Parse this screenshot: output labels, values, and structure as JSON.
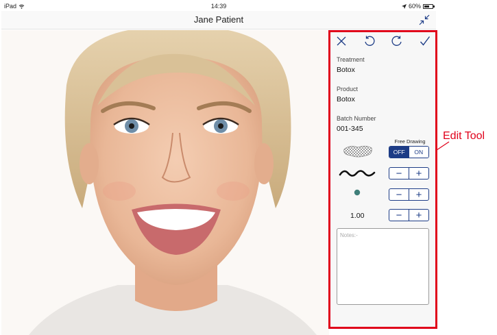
{
  "status_bar": {
    "device": "iPad",
    "time": "14:39",
    "battery": "60%",
    "battery_level": 0.6
  },
  "nav": {
    "title": "Jane Patient",
    "collapse_icon": "collapse-arrows-icon"
  },
  "toolbar": {
    "close_icon": "close-icon",
    "undo_icon": "undo-icon",
    "redo_icon": "redo-icon",
    "confirm_icon": "checkmark-icon"
  },
  "fields": [
    {
      "label": "Treatment",
      "value": "Botox"
    },
    {
      "label": "Product",
      "value": "Botox"
    },
    {
      "label": "Batch Number",
      "value": "001-345"
    }
  ],
  "free_drawing": {
    "label": "Free Drawing",
    "off_label": "OFF",
    "on_label": "ON",
    "selected": "OFF"
  },
  "controls": {
    "line_width_icon": "wave-line-icon",
    "dot_icon": "dot-icon",
    "dot_color": "#3f7f7a",
    "opacity_value": "1.00",
    "minus": "−",
    "plus": "+"
  },
  "notes": {
    "placeholder": "Notes:-",
    "value": ""
  },
  "annotation": {
    "label": "Edit Tool",
    "color": "#e0001a"
  },
  "colors": {
    "accent": "#1d3c86",
    "highlight": "#e0001a"
  }
}
